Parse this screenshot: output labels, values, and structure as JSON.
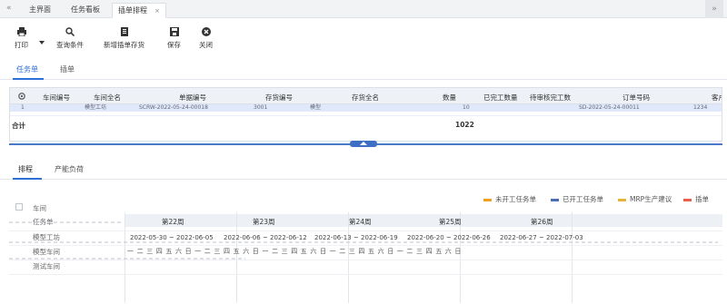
{
  "tabs": {
    "home": "主界面",
    "board": "任务看板",
    "active": "插单排程"
  },
  "toolbar": {
    "print": "打印",
    "query": "查询条件",
    "add_plan": "新增插单存货",
    "save": "保存",
    "close": "关闭"
  },
  "subtabs": {
    "task": "任务单",
    "insert": "插单"
  },
  "grid": {
    "headers": [
      "车间编号",
      "车间全名",
      "单据编号",
      "存货编号",
      "存货全名",
      "数量",
      "已完工数量",
      "待审核完工数",
      "订单号码",
      "客户"
    ],
    "row": [
      "1",
      "模型工坊",
      "SCRW-2022-05-24-00018",
      "3001",
      "模型",
      "10",
      "SD-2022-05-24-00011",
      "1234"
    ],
    "total_label": "合计",
    "total_value": "1022"
  },
  "lowtabs": {
    "schedule": "排程",
    "capacity": "产能负荷"
  },
  "legend": [
    {
      "label": "未开工任务单",
      "color": "#f0a020"
    },
    {
      "label": "已开工任务单",
      "color": "#4a6fb5"
    },
    {
      "label": "MRP生产建议",
      "color": "#e6b43c"
    },
    {
      "label": "插单",
      "color": "#e8604c"
    }
  ],
  "gantt": {
    "header_label": "车间",
    "row_labels": [
      "任务单",
      "模型工坊",
      "模型车间",
      "测试车间"
    ],
    "weeks": [
      "第22周",
      "第23周",
      "第24周",
      "第25周",
      "第26周"
    ],
    "date_ranges": [
      "2022-05-30 ~ 2022-06-05",
      "2022-06-06 ~ 2022-06-12",
      "2022-06-13 ~ 2022-06-19",
      "2022-06-20 ~ 2022-06-26",
      "2022-06-27 ~ 2022-07-03"
    ],
    "days": "一二三四五六日一二三四五六日一二三四五六日一二三四五六日一二三四五六日"
  }
}
